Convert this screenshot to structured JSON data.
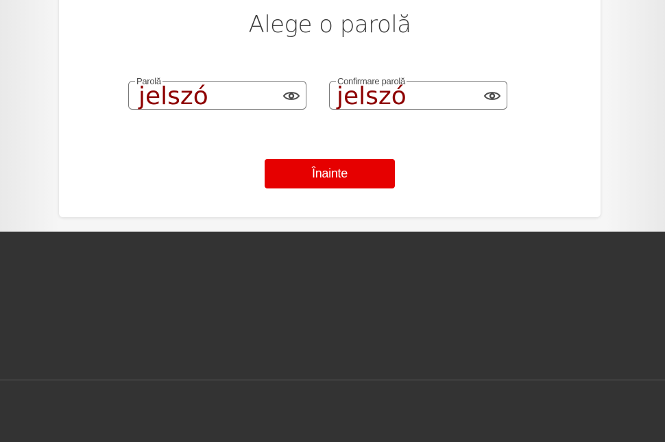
{
  "form": {
    "title": "Alege o parolă",
    "password": {
      "label": "Parolă",
      "value": "jelszó",
      "toggle_icon": "eye-icon"
    },
    "confirm_password": {
      "label": "Confirmare parolă",
      "value": "jelszó",
      "toggle_icon": "eye-icon"
    },
    "submit_label": "Înainte"
  },
  "colors": {
    "accent": "#e60000",
    "field_value_text": "#8e0000",
    "footer_background": "#333333",
    "page_background": "#f6f6f6"
  }
}
